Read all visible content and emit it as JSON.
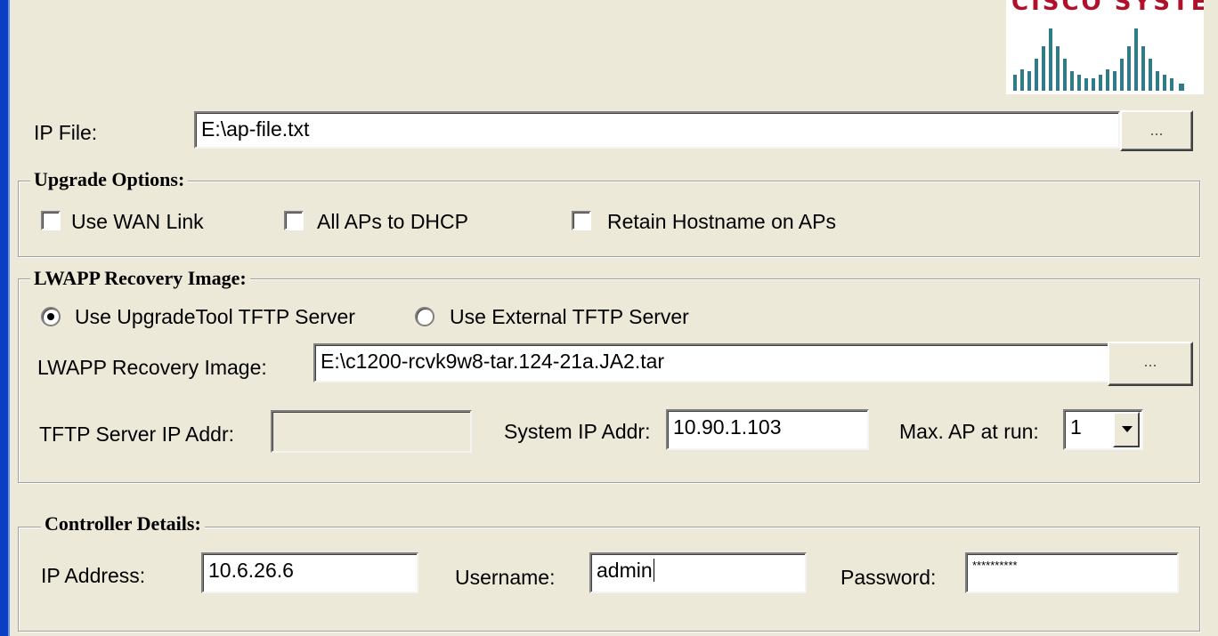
{
  "logo": {
    "text": "CISCO SYSTEMS"
  },
  "ip_file": {
    "label": "IP File:",
    "value": "E:\\ap-file.txt",
    "browse_label": "..."
  },
  "upgrade_options": {
    "title": "Upgrade Options:",
    "use_wan_link": {
      "label": "Use WAN Link",
      "checked": false
    },
    "all_aps_dhcp": {
      "label": "All APs to DHCP",
      "checked": false
    },
    "retain_hostname": {
      "label": "Retain Hostname on APs",
      "checked": false
    }
  },
  "lwapp": {
    "title": "LWAPP Recovery Image:",
    "radio_internal": {
      "label": "Use UpgradeTool TFTP Server",
      "selected": true
    },
    "radio_external": {
      "label": "Use External TFTP Server",
      "selected": false
    },
    "image_label": "LWAPP Recovery Image:",
    "image_value": "E:\\c1200-rcvk9w8-tar.124-21a.JA2.tar",
    "browse_label": "...",
    "tftp_ip_label": "TFTP Server IP Addr:",
    "tftp_ip_value": "",
    "system_ip_label": "System IP Addr:",
    "system_ip_value": "10.90.1.103",
    "max_ap_label": "Max. AP at run:",
    "max_ap_value": "1"
  },
  "controller": {
    "title": "Controller Details:",
    "ip_label": "IP Address:",
    "ip_value": "10.6.26.6",
    "username_label": "Username:",
    "username_value": "admin",
    "password_label": "Password:",
    "password_value": "**********"
  }
}
